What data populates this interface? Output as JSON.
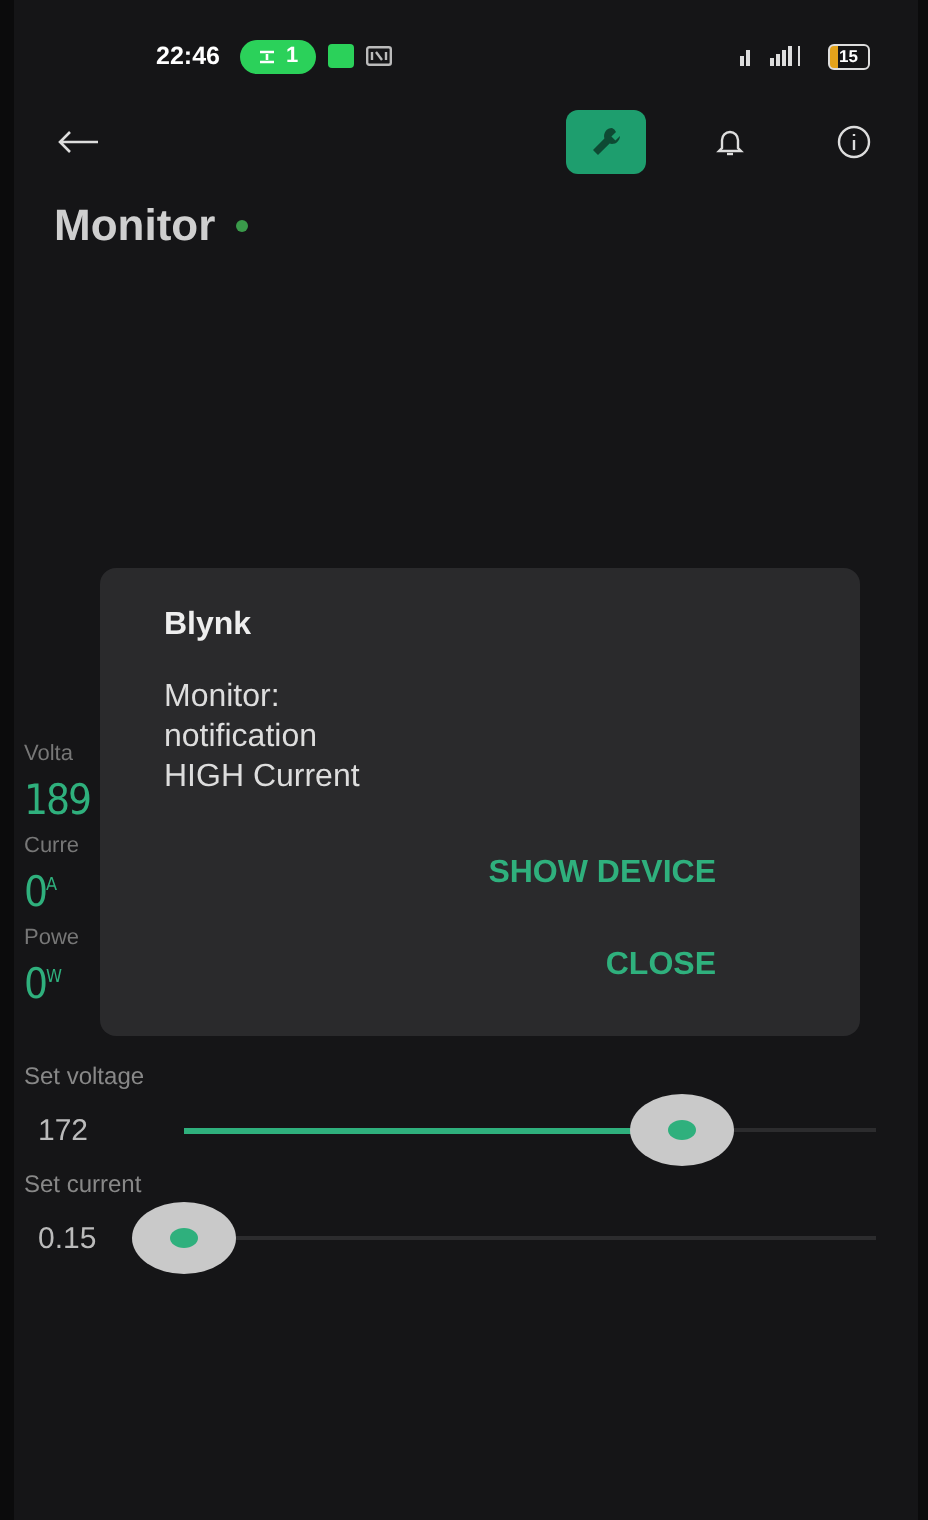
{
  "status_bar": {
    "time": "22:46",
    "call_badge": "1",
    "battery": "15"
  },
  "header": {
    "actions": [
      {
        "kind": "wrench",
        "selected": true
      },
      {
        "kind": "bell",
        "selected": false
      },
      {
        "kind": "info",
        "selected": false
      }
    ]
  },
  "title": "Monitor",
  "online": true,
  "readings": [
    {
      "label": "Volta",
      "value": "189"
    },
    {
      "label": "Curre",
      "value": "0",
      "unit": "A"
    },
    {
      "label": "Powe",
      "value": "0",
      "unit": "W"
    }
  ],
  "dialog": {
    "title": "Blynk",
    "message": [
      "Monitor:",
      "notification",
      "HIGH Current"
    ],
    "buttons": [
      "SHOW DEVICE",
      "CLOSE"
    ]
  },
  "sliders": [
    {
      "label": "Set voltage",
      "reading": "172",
      "level": 0.72
    },
    {
      "label": "Set current",
      "reading": "0.15",
      "level": 0
    }
  ]
}
